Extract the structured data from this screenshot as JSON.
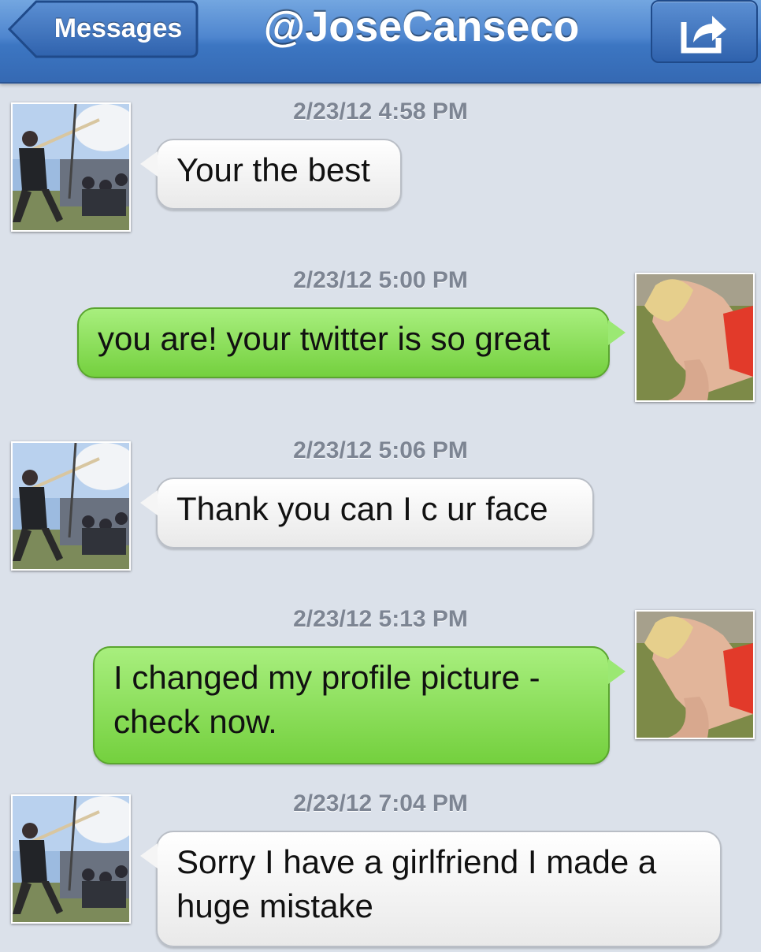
{
  "navbar": {
    "back_label": "Messages",
    "title": "@JoseCanseco",
    "share_icon": "share-arrow-icon"
  },
  "colors": {
    "navbar": "#3c76c2",
    "incoming_bubble": "#f2f2f2",
    "outgoing_bubble": "#86de55",
    "background": "#dbe1ea"
  },
  "messages": [
    {
      "timestamp": "2/23/12 4:58 PM",
      "direction": "incoming",
      "text": "Your the best",
      "avatar": "baseball-player-avatar"
    },
    {
      "timestamp": "2/23/12 5:00 PM",
      "direction": "outgoing",
      "text": "you are! your twitter is so great",
      "avatar": "user-avatar"
    },
    {
      "timestamp": "2/23/12 5:06 PM",
      "direction": "incoming",
      "text": "Thank you can I c ur face",
      "avatar": "baseball-player-avatar"
    },
    {
      "timestamp": "2/23/12 5:13 PM",
      "direction": "outgoing",
      "text": "I changed my profile picture -\ncheck now.",
      "avatar": "user-avatar"
    },
    {
      "timestamp": "2/23/12 7:04 PM",
      "direction": "incoming",
      "text": "Sorry I have a girlfriend I made a\nhuge mistake",
      "avatar": "baseball-player-avatar"
    }
  ]
}
